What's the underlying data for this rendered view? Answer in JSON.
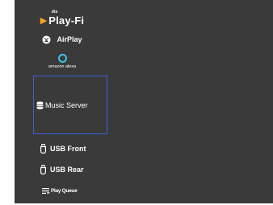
{
  "menu": {
    "items": [
      {
        "id": "play-fi",
        "brand_prefix": "dts",
        "label": "Play-Fi",
        "icon": "play-fi-arrow-icon",
        "accent": "#f5a623"
      },
      {
        "id": "airplay",
        "label": "AirPlay",
        "icon": "airplay-icon"
      },
      {
        "id": "alexa",
        "label": "amazon alexa",
        "icon": "alexa-ring-icon",
        "accent": "#3dc3e8"
      },
      {
        "id": "music-server",
        "label": "Music Server",
        "icon": "database-icon",
        "selected": true
      },
      {
        "id": "usb-front",
        "label": "USB Front",
        "icon": "usb-icon"
      },
      {
        "id": "usb-rear",
        "label": "USB Rear",
        "icon": "usb-icon"
      },
      {
        "id": "play-queue",
        "label": "Play Queue",
        "icon": "play-queue-icon"
      }
    ]
  },
  "colors": {
    "panel_background": "#3a3a3a",
    "text": "#ffffff",
    "selection_border": "#3c5fe0"
  }
}
